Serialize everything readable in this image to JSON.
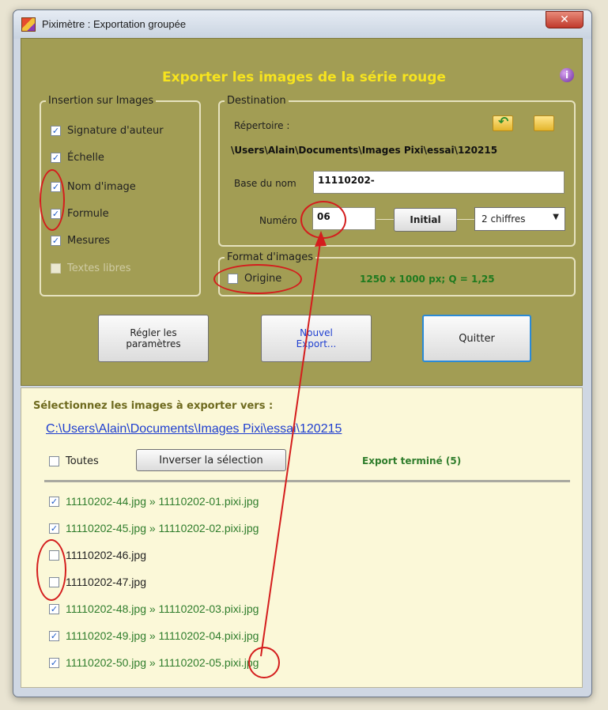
{
  "window": {
    "title": "Piximètre : Exportation groupée",
    "close_label": "✕"
  },
  "header": {
    "title": "Exporter les images de la série rouge",
    "info_label": "i",
    "title_color": "#f7e41e",
    "panel_color": "#a29d54"
  },
  "insertion": {
    "legend": "Insertion sur Images",
    "items": [
      {
        "label": "Signature d'auteur",
        "checked": true,
        "enabled": true
      },
      {
        "label": "Échelle",
        "checked": true,
        "enabled": true
      },
      {
        "label": "Nom d'image",
        "checked": true,
        "enabled": true
      },
      {
        "label": "Formule",
        "checked": true,
        "enabled": true
      },
      {
        "label": "Mesures",
        "checked": true,
        "enabled": true
      },
      {
        "label": "Textes libres",
        "checked": false,
        "enabled": false
      }
    ]
  },
  "destination": {
    "legend": "Destination",
    "repertoire_label": "Répertoire :",
    "path": "\\Users\\Alain\\Documents\\Images Pixi\\essai\\120215",
    "base_label": "Base du nom",
    "base_value": "11110202-",
    "numero_label": "Numéro",
    "numero_value": "06",
    "initial_button": "Initial",
    "digits_select": "2 chiffres"
  },
  "format": {
    "legend": "Format d'images",
    "origine_label": "Origine",
    "origine_checked": false,
    "info": "1250 x 1000 px; Q = 1,25"
  },
  "buttons": {
    "regler_line1": "Régler les",
    "regler_line2": "paramètres",
    "nouvel_line1": "Nouvel",
    "nouvel_line2": "Export...",
    "quitter": "Quitter"
  },
  "export": {
    "select_label": "Sélectionnez les images à exporter vers :",
    "path_link": "C:\\Users\\Alain\\Documents\\Images Pixi\\essai\\120215",
    "toutes_label": "Toutes",
    "inverser_button": "Inverser la sélection",
    "status": "Export terminé  (5)",
    "link_color": "#1f3fd0",
    "done_color": "#2f7d2c"
  },
  "files": [
    {
      "text": "11110202-44.jpg  »  11110202-01.pixi.jpg",
      "checked": true,
      "exported": true
    },
    {
      "text": "11110202-45.jpg  »  11110202-02.pixi.jpg",
      "checked": true,
      "exported": true
    },
    {
      "text": "11110202-46.jpg",
      "checked": false,
      "exported": false
    },
    {
      "text": "11110202-47.jpg",
      "checked": false,
      "exported": false
    },
    {
      "text": "11110202-48.jpg  »  11110202-03.pixi.jpg",
      "checked": true,
      "exported": true
    },
    {
      "text": "11110202-49.jpg  »  11110202-04.pixi.jpg",
      "checked": true,
      "exported": true
    },
    {
      "text": "11110202-50.jpg  »  11110202-05.pixi.jpg",
      "checked": true,
      "exported": true
    }
  ],
  "annotation_color": "#d41d1d"
}
